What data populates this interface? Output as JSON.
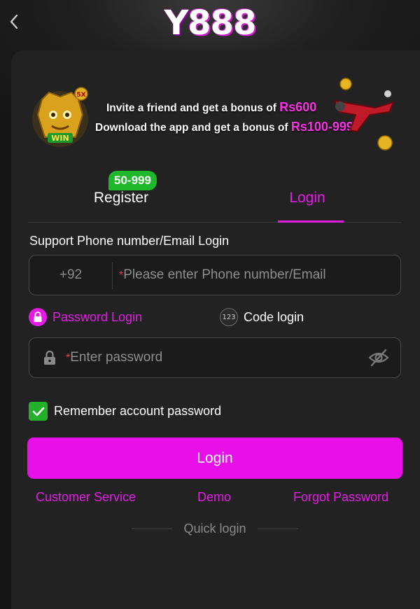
{
  "header": {
    "back_icon": "chevron-left-icon",
    "logo_y": "Y",
    "logo_num": "888"
  },
  "banner": {
    "invite_text": "Invite a friend and get a bonus of",
    "invite_amount": "Rs600",
    "download_text": "Download the app and get a bonus of",
    "download_amount": "Rs100-999",
    "trophy_text": "WIN",
    "multiplier_text": "5X"
  },
  "tabs": {
    "register_label": "Register",
    "register_badge": "50-999",
    "login_label": "Login",
    "active": "Login"
  },
  "form": {
    "support_label": "Support Phone number/Email Login",
    "country_code": "+92",
    "required_mark": "*",
    "phone_placeholder": "Please enter Phone number/Email",
    "password_login_label": "Password Login",
    "code_login_icon_text": "123",
    "code_login_label": "Code login",
    "password_placeholder": "Enter password",
    "remember_label": "Remember account password",
    "remember_checked": true,
    "login_button": "Login"
  },
  "links": {
    "customer_service": "Customer Service",
    "demo": "Demo",
    "forgot_password": "Forgot Password"
  },
  "quick_login_label": "Quick login",
  "colors": {
    "accent": "#e41be4",
    "badge_green": "#1fb82a",
    "background": "#141414",
    "card": "#222222"
  }
}
